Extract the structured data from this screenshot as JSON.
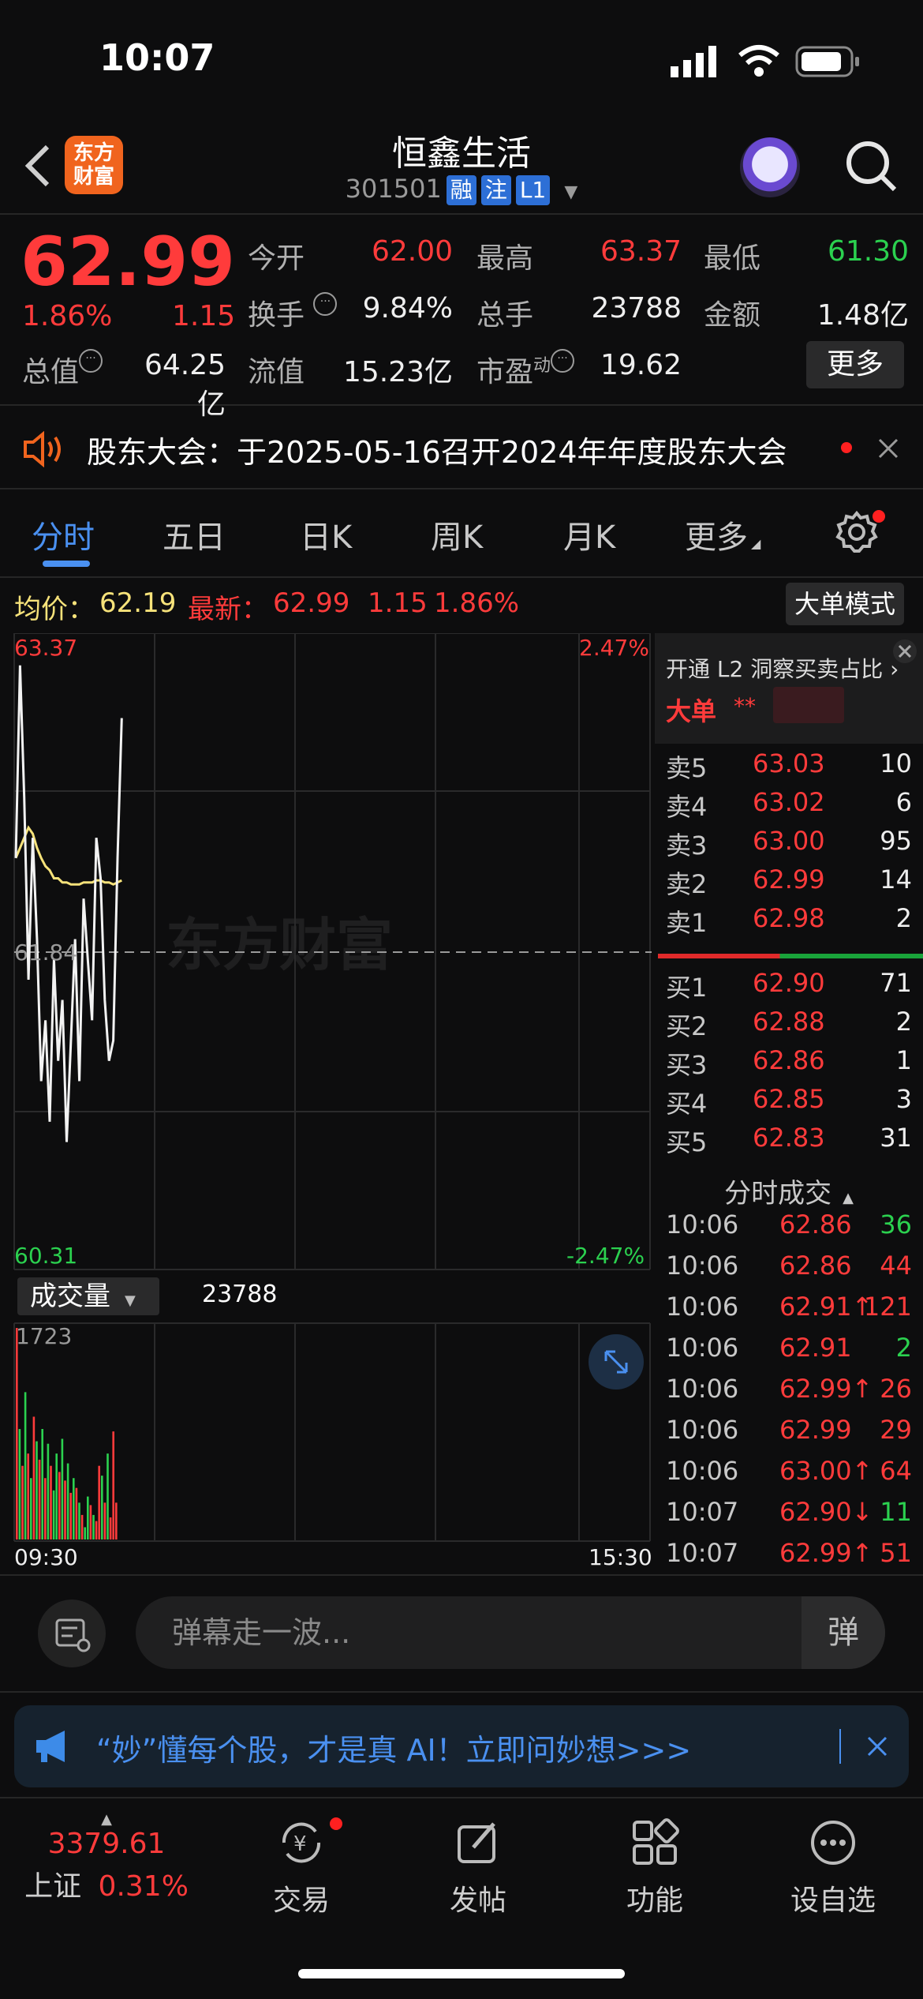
{
  "status_bar": {
    "time": "10:07"
  },
  "header": {
    "back_icon": "chevron-left-icon",
    "logo_text": "东方财富",
    "title": "恒鑫生活",
    "code": "301501",
    "badges": [
      "融",
      "注",
      "L1"
    ],
    "search_icon": "search-icon"
  },
  "quote": {
    "price": "62.99",
    "pct": "1.86%",
    "change": "1.15",
    "open_label": "今开",
    "open": "62.00",
    "high_label": "最高",
    "high": "63.37",
    "low_label": "最低",
    "low": "61.30",
    "turnover_label": "换手",
    "turnover": "9.84%",
    "volume_label": "总手",
    "volume": "23788",
    "amount_label": "金额",
    "amount": "1.48亿",
    "mktcap_label": "总值",
    "mktcap": "64.25亿",
    "float_label": "流值",
    "float": "15.23亿",
    "pe_label": "市盈",
    "pe_sup": "动",
    "pe": "19.62",
    "more": "更多"
  },
  "notice": {
    "text": "股东大会：于2025-05-16召开2024年年度股东大会"
  },
  "tabs": [
    "分时",
    "五日",
    "日K",
    "周K",
    "月K",
    "更多"
  ],
  "info_line": {
    "avg_label": "均价：",
    "avg": "62.19",
    "latest_label": "最新：",
    "latest": "62.99",
    "change": "1.15",
    "pct": "1.86%",
    "big_order_mode": "大单模式"
  },
  "chart": {
    "y_max": "63.37",
    "y_mid": "61.84",
    "y_min": "60.31",
    "pct_max": "2.47%",
    "pct_min": "-2.47%",
    "volume_label": "成交量",
    "volume_total": "23788",
    "volume_max": "1723",
    "time_start": "09:30",
    "time_end": "15:30",
    "watermark": "东方财富"
  },
  "chart_data": {
    "type": "line",
    "title": "",
    "xlabel": "",
    "ylabel": "",
    "ylim": [
      60.31,
      63.37
    ],
    "series": [
      {
        "name": "",
        "values": [
          62.3,
          63.25,
          62.6,
          61.7,
          62.4,
          61.9,
          61.2,
          61.5,
          61.0,
          61.8,
          61.3,
          61.6,
          60.9,
          61.4,
          61.9,
          61.2,
          62.1,
          61.8,
          61.5,
          62.4,
          62.2,
          61.6,
          61.3,
          61.4,
          62.3,
          62.99
        ]
      },
      {
        "name": "均价",
        "values": [
          62.3,
          62.35,
          62.4,
          62.45,
          62.42,
          62.35,
          62.3,
          62.26,
          62.24,
          62.2,
          62.2,
          62.18,
          62.18,
          62.17,
          62.17,
          62.17,
          62.18,
          62.18,
          62.18,
          62.19,
          62.19,
          62.18,
          62.18,
          62.17,
          62.18,
          62.19
        ]
      }
    ],
    "volume_bars": [
      1723,
      900,
      600,
      1200,
      700,
      500,
      1000,
      800,
      650,
      900,
      500,
      780,
      600,
      400,
      700,
      550,
      820,
      480,
      620,
      380,
      500,
      420,
      300,
      200,
      100,
      350,
      280,
      200,
      150,
      600,
      520,
      300,
      700,
      180,
      880,
      300
    ],
    "volume_colors": [
      "r",
      "g",
      "r",
      "g",
      "r",
      "g",
      "r",
      "g",
      "r",
      "g",
      "r",
      "g",
      "r",
      "g",
      "g",
      "r",
      "g",
      "r",
      "g",
      "r",
      "g",
      "r",
      "g",
      "r",
      "g",
      "g",
      "r",
      "g",
      "r",
      "r",
      "g",
      "r",
      "g",
      "r",
      "r",
      "r"
    ]
  },
  "book": {
    "l2_text": "开通 L2 洞察买卖占比",
    "big_order": "大单",
    "big_order_mask": "**",
    "asks": [
      {
        "label": "卖5",
        "price": "63.03",
        "qty": "10"
      },
      {
        "label": "卖4",
        "price": "63.02",
        "qty": "6"
      },
      {
        "label": "卖3",
        "price": "63.00",
        "qty": "95"
      },
      {
        "label": "卖2",
        "price": "62.99",
        "qty": "14"
      },
      {
        "label": "卖1",
        "price": "62.98",
        "qty": "2"
      }
    ],
    "bids": [
      {
        "label": "买1",
        "price": "62.90",
        "qty": "71"
      },
      {
        "label": "买2",
        "price": "62.88",
        "qty": "2"
      },
      {
        "label": "买3",
        "price": "62.86",
        "qty": "1"
      },
      {
        "label": "买4",
        "price": "62.85",
        "qty": "3"
      },
      {
        "label": "买5",
        "price": "62.83",
        "qty": "31"
      }
    ],
    "ticks_title": "分时成交",
    "ticks": [
      {
        "time": "10:06",
        "price": "62.86",
        "qty": "36",
        "dir": "",
        "qcolor": "green"
      },
      {
        "time": "10:06",
        "price": "62.86",
        "qty": "44",
        "dir": "",
        "qcolor": "red"
      },
      {
        "time": "10:06",
        "price": "62.91↑",
        "qty": "121",
        "dir": "up",
        "qcolor": "red"
      },
      {
        "time": "10:06",
        "price": "62.91",
        "qty": "2",
        "dir": "",
        "qcolor": "green"
      },
      {
        "time": "10:06",
        "price": "62.99↑",
        "qty": "26",
        "dir": "up",
        "qcolor": "red"
      },
      {
        "time": "10:06",
        "price": "62.99",
        "qty": "29",
        "dir": "",
        "qcolor": "red"
      },
      {
        "time": "10:06",
        "price": "63.00↑",
        "qty": "64",
        "dir": "up",
        "qcolor": "red"
      },
      {
        "time": "10:07",
        "price": "62.90↓",
        "qty": "11",
        "dir": "down",
        "qcolor": "green"
      },
      {
        "time": "10:07",
        "price": "62.99↑",
        "qty": "51",
        "dir": "up",
        "qcolor": "red"
      }
    ]
  },
  "danmu": {
    "placeholder": "弹幕走一波...",
    "button": "弹"
  },
  "ad": {
    "text": "“妙”懂每个股，才是真 AI！立即问妙想>>>"
  },
  "nav": {
    "index_value": "3379.61",
    "index_name": "上证",
    "index_pct": "0.31%",
    "items": [
      "交易",
      "发帖",
      "功能",
      "设自选"
    ]
  },
  "colors": {
    "up": "#ff3b3b",
    "down": "#2bd14f",
    "accent": "#4a90f0",
    "avg_line": "#f6e27a"
  }
}
